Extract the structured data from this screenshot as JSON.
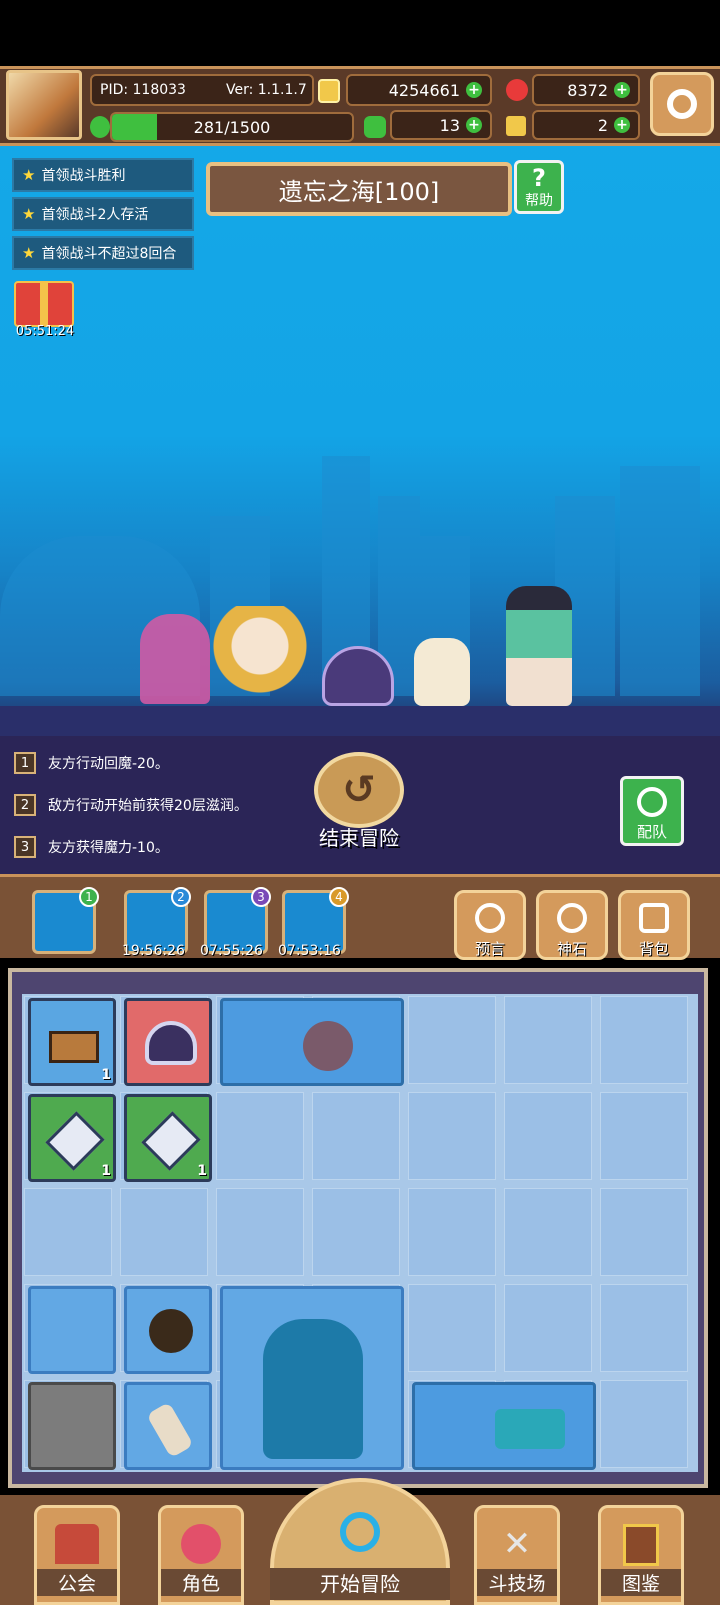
{
  "hud": {
    "pid": "PID: 118033",
    "version": "Ver: 1.1.1.7",
    "gold": "4254661",
    "gems": "8372",
    "stamina": "281/1500",
    "stamina_fraction": 0.187,
    "clover": "13",
    "key": "2"
  },
  "quests": [
    {
      "label": "首领战斗胜利"
    },
    {
      "label": "首领战斗2人存活"
    },
    {
      "label": "首领战斗不超过8回合"
    }
  ],
  "stage": {
    "title": "遗忘之海[100]"
  },
  "help_label": "帮助",
  "gift_timer": "05:51:24",
  "log": [
    {
      "num": "1",
      "text": "友方行动回魔-20。"
    },
    {
      "num": "2",
      "text": "敌方行动开始前获得20层滋润。"
    },
    {
      "num": "3",
      "text": "友方获得魔力-10。"
    }
  ],
  "end_button": "结束冒险",
  "team_button": "配队",
  "maps": [
    {
      "badge": "1",
      "time": ""
    },
    {
      "badge": "2",
      "time": "19:56:26"
    },
    {
      "badge": "3",
      "time": "07:55:26"
    },
    {
      "badge": "4",
      "time": "07:53:16"
    }
  ],
  "tools": [
    {
      "label": "预言",
      "icon": "prophecy-icon"
    },
    {
      "label": "神石",
      "icon": "divine-stone-icon"
    },
    {
      "label": "背包",
      "icon": "backpack-icon"
    }
  ],
  "inventory": {
    "counts": {
      "treasure": "1",
      "crystal_a": "1",
      "crystal_b": "1"
    }
  },
  "nav": [
    {
      "label": "公会"
    },
    {
      "label": "角色"
    },
    {
      "label": "开始冒险"
    },
    {
      "label": "斗技场"
    },
    {
      "label": "图鉴"
    }
  ],
  "colors": {
    "sky": "#13a4e6",
    "panel": "#2b2557",
    "wood": "#7a5236",
    "accent_green": "#3db24d"
  }
}
